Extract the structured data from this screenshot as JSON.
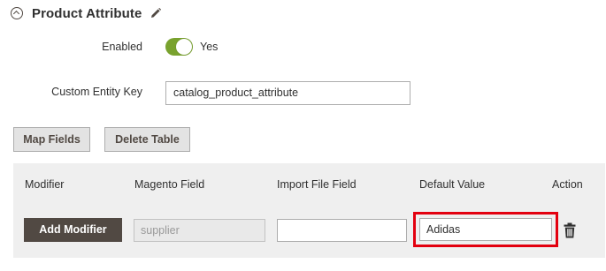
{
  "section": {
    "title": "Product Attribute",
    "collapse_icon": "chevron-up-circle-icon",
    "edit_icon": "pencil-icon"
  },
  "fields": {
    "enabled": {
      "label": "Enabled",
      "state": "on",
      "state_label": "Yes",
      "toggle_color": "#79a22e"
    },
    "custom_entity_key": {
      "label": "Custom Entity Key",
      "value": "catalog_product_attribute"
    }
  },
  "buttons": {
    "map_fields": "Map Fields",
    "delete_table": "Delete Table"
  },
  "grid": {
    "columns": [
      "Modifier",
      "Magento Field",
      "Import File Field",
      "Default Value",
      "Action"
    ],
    "row": {
      "add_modifier_label": "Add Modifier",
      "magento_field_placeholder": "supplier",
      "import_file_field_value": "",
      "default_value": "Adidas",
      "action_icon": "trash-icon"
    },
    "highlight_color": "#e3000f"
  }
}
